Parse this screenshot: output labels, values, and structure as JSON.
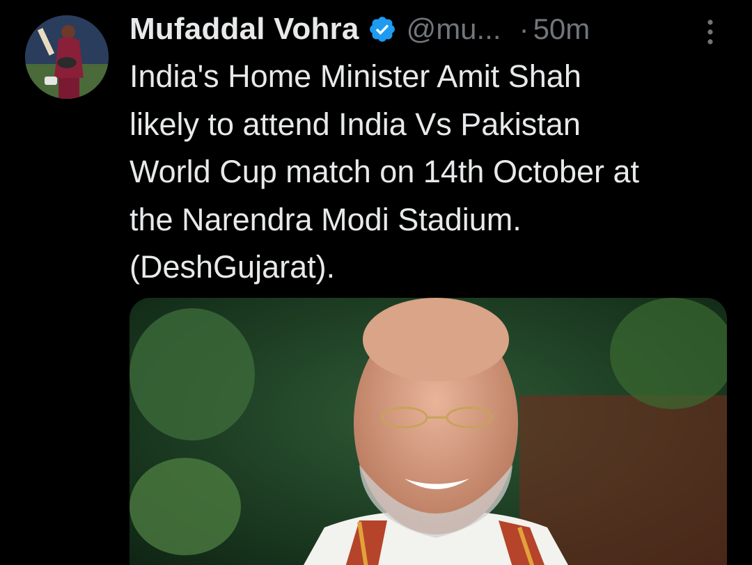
{
  "tweet": {
    "author": {
      "display_name": "Mufaddal Vohra",
      "handle": "@mu...",
      "verified": true,
      "avatar_icon": "user-avatar-cricketer"
    },
    "separator": "·",
    "timestamp": "50m",
    "text": "India's Home Minister Amit Shah\nlikely to attend India Vs Pakistan\nWorld Cup match on 14th October at\nthe Narendra Modi Stadium.\n(DeshGujarat).",
    "media": {
      "type": "photo",
      "icon": "photo-portrait"
    },
    "more_icon": "more-vertical-icon"
  },
  "colors": {
    "background": "#000000",
    "primary_text": "#e7e9ea",
    "secondary_text": "#71767b",
    "verified_blue": "#1d9bf0"
  }
}
